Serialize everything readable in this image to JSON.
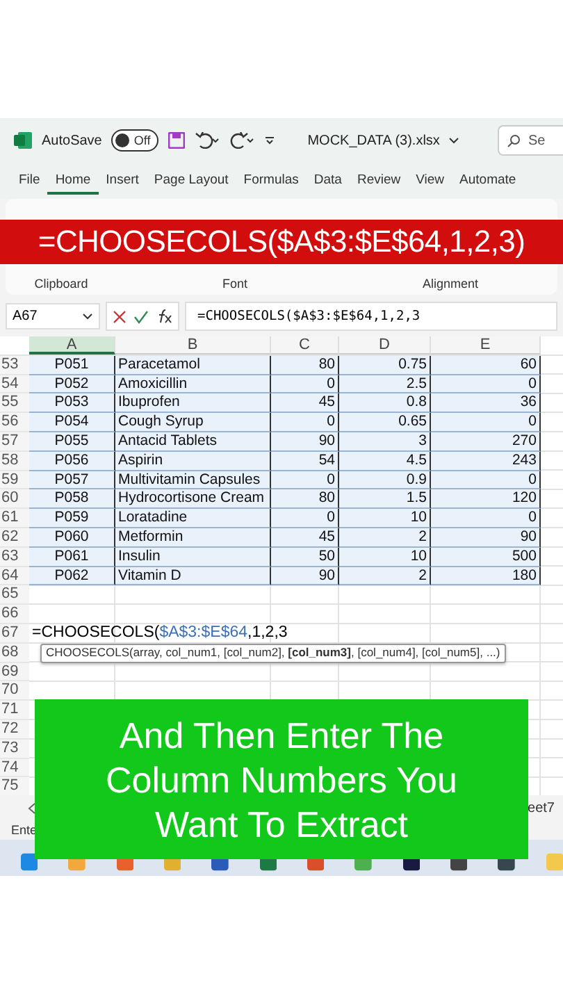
{
  "title_bar": {
    "autosave_label": "AutoSave",
    "autosave_toggle": {
      "label": "Off",
      "on": false
    },
    "filename": "MOCK_DATA (3).xlsx",
    "search": "Se"
  },
  "ribbon_tabs": [
    {
      "label": "File",
      "selected": false
    },
    {
      "label": "Home",
      "selected": true
    },
    {
      "label": "Insert",
      "selected": false
    },
    {
      "label": "Page Layout",
      "selected": false
    },
    {
      "label": "Formulas",
      "selected": false
    },
    {
      "label": "Data",
      "selected": false
    },
    {
      "label": "Review",
      "selected": false
    },
    {
      "label": "View",
      "selected": false
    },
    {
      "label": "Automate",
      "selected": false
    }
  ],
  "ribbon_groups": [
    "Clipboard",
    "Font",
    "Alignment"
  ],
  "banner": "=CHOOSECOLS($A$3:$E$64,1,2,3)",
  "formula_bar": {
    "name_box": "A67",
    "formula": "=CHOOSECOLS($A$3:$E$64,1,2,3"
  },
  "columns": [
    {
      "label": "A",
      "selected": true
    },
    {
      "label": "B",
      "selected": false
    },
    {
      "label": "C",
      "selected": false
    },
    {
      "label": "D",
      "selected": false
    },
    {
      "label": "E",
      "selected": false
    }
  ],
  "rows": [
    {
      "number": "53",
      "cells": [
        "P051",
        "Paracetamol",
        "80",
        "0.75",
        "60"
      ]
    },
    {
      "number": "54",
      "cells": [
        "P052",
        "Amoxicillin",
        "0",
        "2.5",
        "0"
      ]
    },
    {
      "number": "55",
      "cells": [
        "P053",
        "Ibuprofen",
        "45",
        "0.8",
        "36"
      ]
    },
    {
      "number": "56",
      "cells": [
        "P054",
        "Cough Syrup",
        "0",
        "0.65",
        "0"
      ]
    },
    {
      "number": "57",
      "cells": [
        "P055",
        "Antacid Tablets",
        "90",
        "3",
        "270"
      ]
    },
    {
      "number": "58",
      "cells": [
        "P056",
        "Aspirin",
        "54",
        "4.5",
        "243"
      ]
    },
    {
      "number": "59",
      "cells": [
        "P057",
        "Multivitamin Capsules",
        "0",
        "0.9",
        "0"
      ]
    },
    {
      "number": "60",
      "cells": [
        "P058",
        "Hydrocortisone Cream",
        "80",
        "1.5",
        "120"
      ]
    },
    {
      "number": "61",
      "cells": [
        "P059",
        "Loratadine",
        "0",
        "10",
        "0"
      ]
    },
    {
      "number": "62",
      "cells": [
        "P060",
        "Metformin",
        "45",
        "2",
        "90"
      ]
    },
    {
      "number": "63",
      "cells": [
        "P061",
        "Insulin",
        "50",
        "10",
        "500"
      ]
    },
    {
      "number": "64",
      "cells": [
        "P062",
        "Vitamin D",
        "90",
        "2",
        "180"
      ]
    },
    {
      "number": "65"
    },
    {
      "number": "66"
    },
    {
      "number": "67",
      "entry": {
        "prefix": "=CHOOSECOLS(",
        "reference": "$A$3:$E$64",
        "suffix": ",1,2,3"
      }
    },
    {
      "number": "68",
      "tooltip": "CHOOSECOLS(array, col_num1, [col_num2], **[col_num3]**, [col_num4], [col_num5], ...)"
    },
    {
      "number": "69"
    },
    {
      "number": "70"
    },
    {
      "number": "71"
    },
    {
      "number": "72"
    },
    {
      "number": "73"
    },
    {
      "number": "74"
    },
    {
      "number": "75"
    }
  ],
  "sheet_tab": "eet7",
  "status": "Ente",
  "caption": "And Then Enter The Column Numbers You Want To Extract"
}
